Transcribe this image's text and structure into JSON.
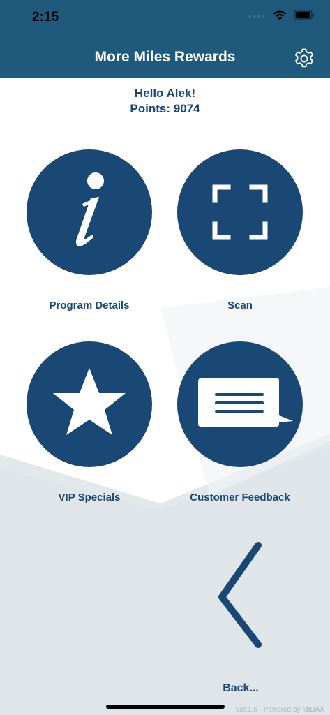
{
  "status_bar": {
    "time": "2:15",
    "icons": [
      "signal-dots-icon",
      "wifi-icon",
      "battery-icon"
    ]
  },
  "header": {
    "title": "More Miles Rewards",
    "settings_icon": "gear-icon"
  },
  "greeting": {
    "hello": "Hello Alek!",
    "points": "Points: 9074"
  },
  "tiles": [
    {
      "label": "Program Details",
      "icon": "info-icon"
    },
    {
      "label": "Scan",
      "icon": "scan-frame-icon"
    },
    {
      "label": "VIP Specials",
      "icon": "star-icon"
    },
    {
      "label": "Customer Feedback",
      "icon": "message-bubble-icon"
    }
  ],
  "back": {
    "label": "Back...",
    "icon": "chevron-left-icon"
  },
  "footer": {
    "version": "Ver:1.6 - Powered by MIDAX"
  },
  "colors": {
    "header_bg": "#1f5a7c",
    "accent": "#184873",
    "background_shape": "#e3e8eb"
  }
}
